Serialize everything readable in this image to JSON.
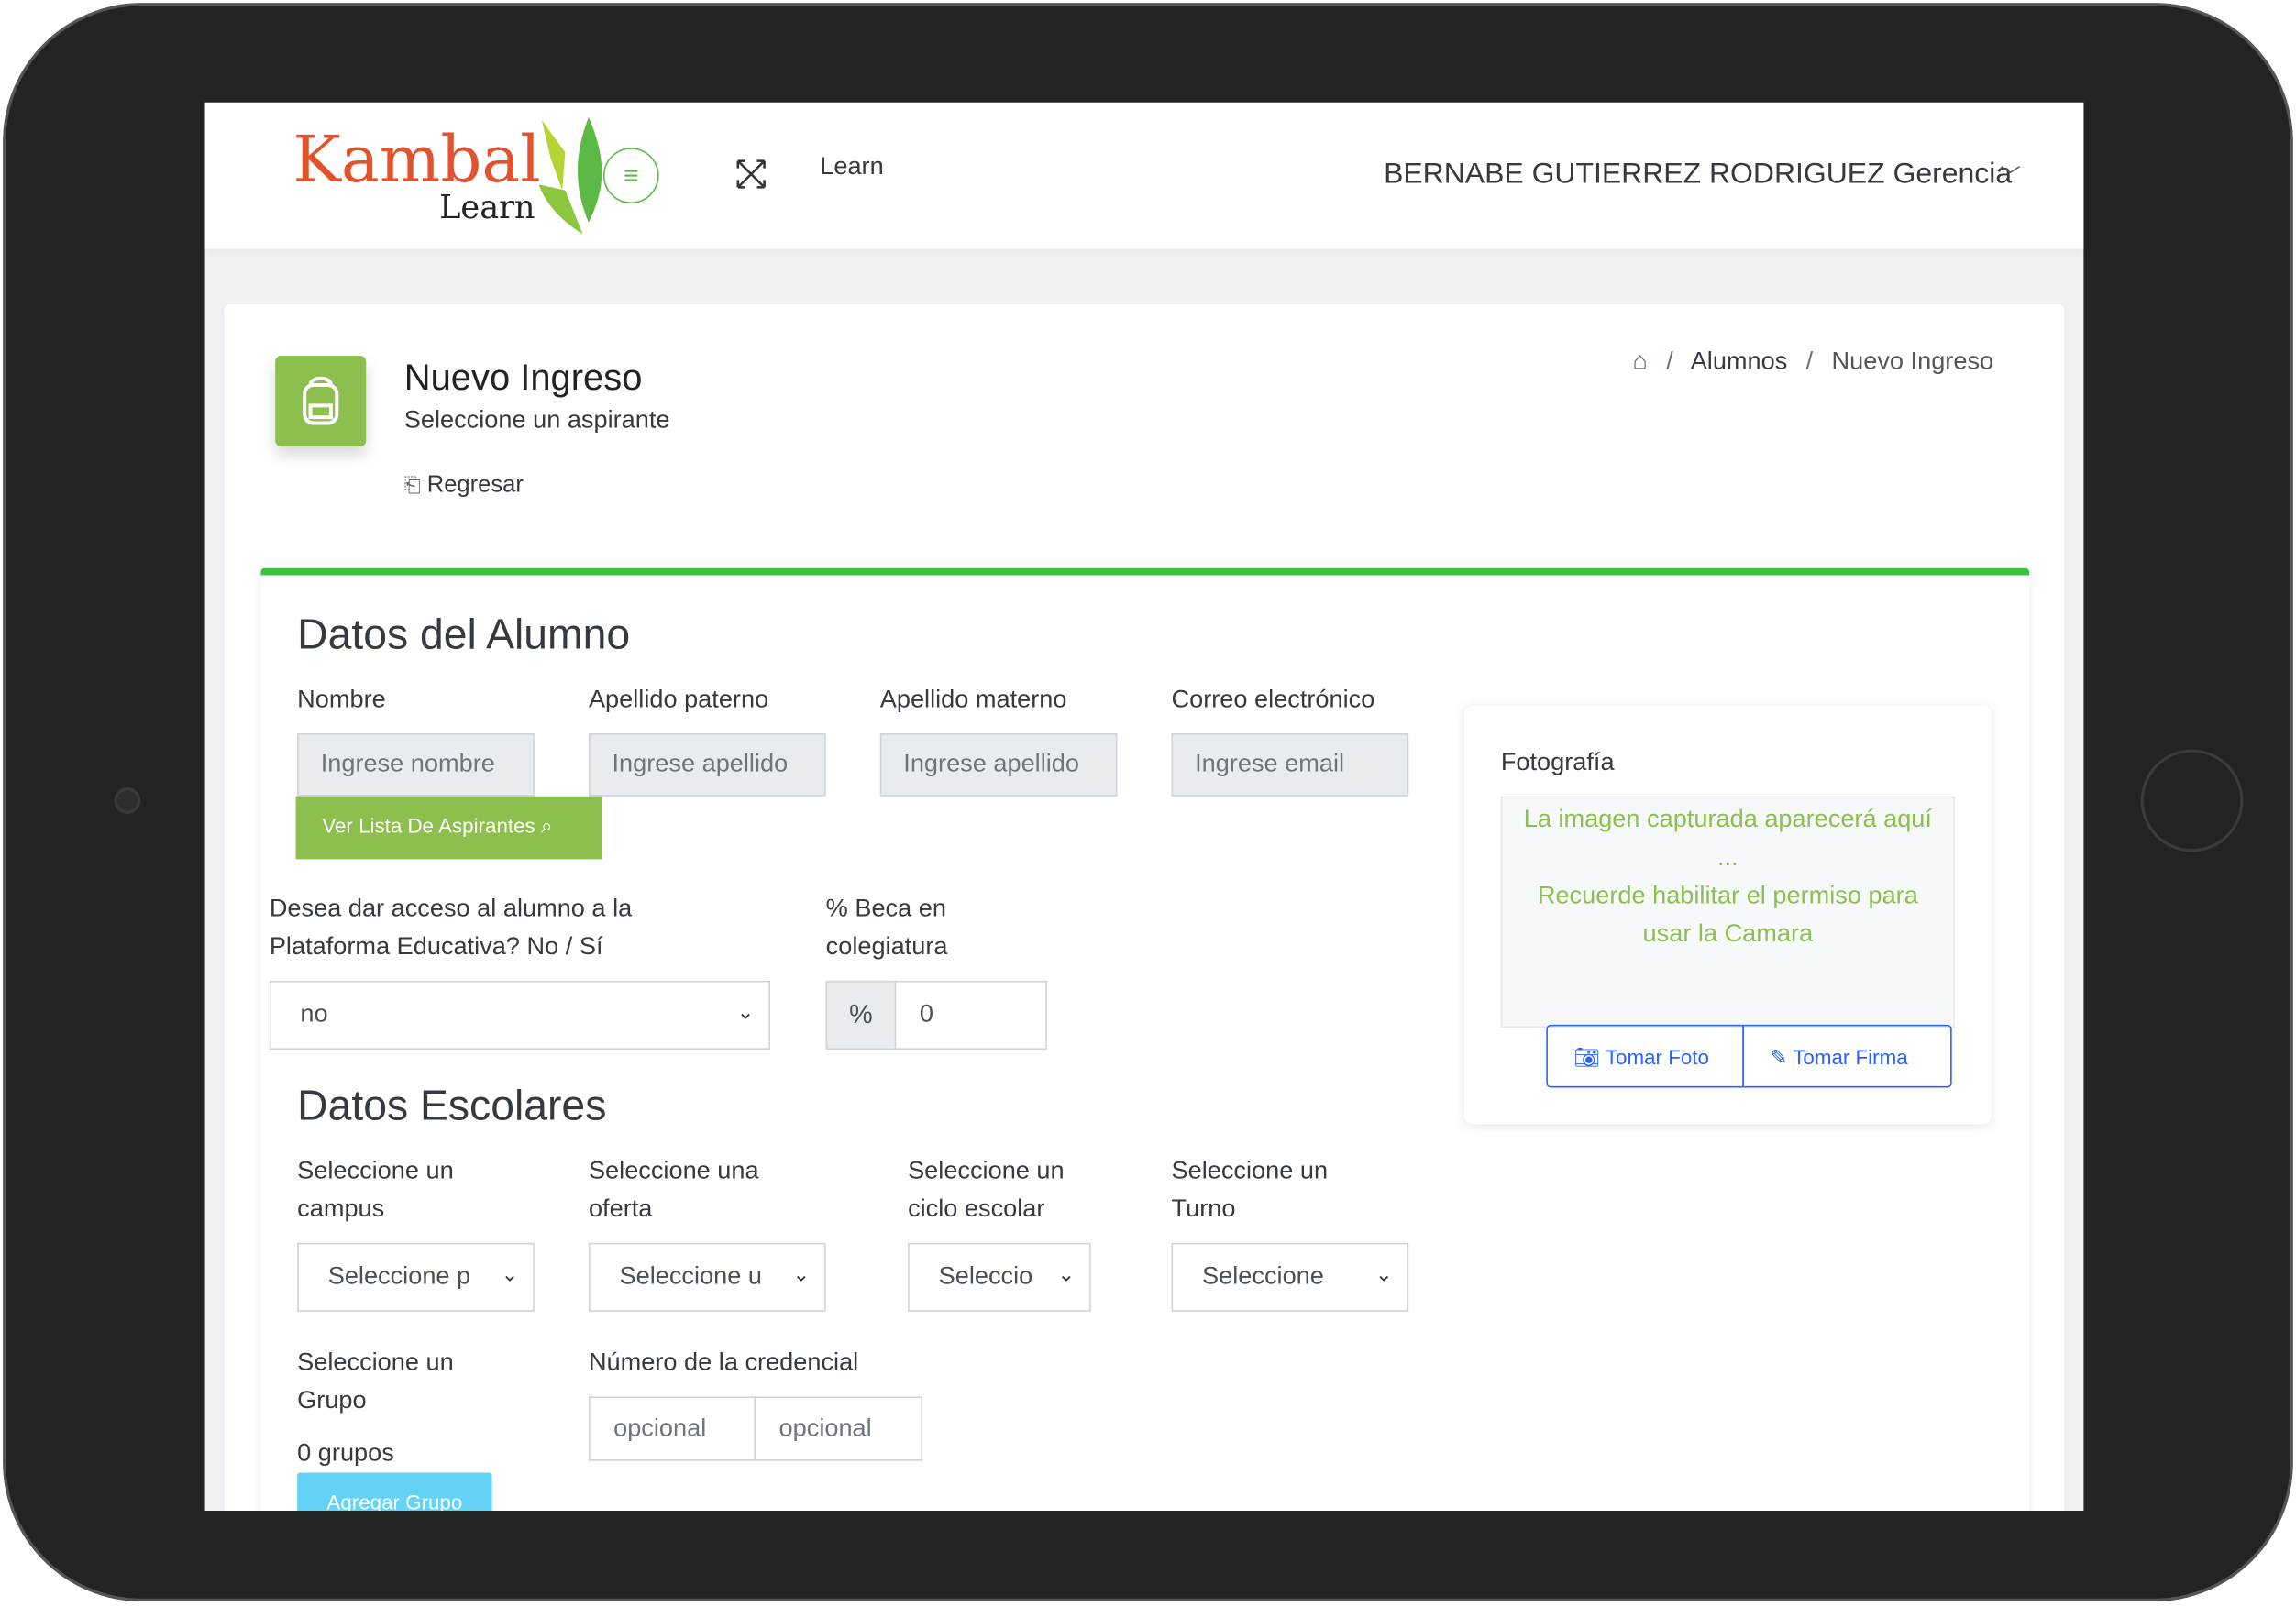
{
  "header": {
    "logo_text": "Kambal",
    "logo_sub": "Learn",
    "nav_link": "Learn",
    "user": "BERNABE GUTIERREZ RODRIGUEZ Gerencia"
  },
  "page": {
    "title": "Nuevo Ingreso",
    "subtitle": "Seleccione un aspirante",
    "back": "Regresar"
  },
  "breadcrumb": {
    "items": [
      "Alumnos",
      "Nuevo Ingreso"
    ]
  },
  "alumno": {
    "heading": "Datos del Alumno",
    "fields": [
      {
        "label": "Nombre",
        "placeholder": "Ingrese nombre"
      },
      {
        "label": "Apellido paterno",
        "placeholder": "Ingrese apellido"
      },
      {
        "label": "Apellido materno",
        "placeholder": "Ingrese apellido"
      },
      {
        "label": "Correo electrónico",
        "placeholder": "Ingrese email"
      }
    ],
    "list_button": "Ver Lista De Aspirantes",
    "access_label_1": "Desea dar acceso al alumno a la",
    "access_label_2": "Plataforma Educativa? No / Sí",
    "access_value": "no",
    "beca_label_1": "% Beca en",
    "beca_label_2": "colegiatura",
    "beca_prefix": "%",
    "beca_value": "0"
  },
  "foto": {
    "label": "Fotografía",
    "msg1": "La imagen capturada aparecerá aquí",
    "msg2": "...",
    "msg3": "Recuerde habilitar el permiso para",
    "msg4": "usar la Camara",
    "take_photo": "Tomar Foto",
    "take_signature": "Tomar Firma"
  },
  "escolares": {
    "heading": "Datos Escolares",
    "selects": [
      {
        "l1": "Seleccione un",
        "l2": "campus",
        "value": "Seleccione p"
      },
      {
        "l1": "Seleccione una",
        "l2": "oferta",
        "value": "Seleccione u"
      },
      {
        "l1": "Seleccione un",
        "l2": "ciclo escolar",
        "value": "Seleccio"
      },
      {
        "l1": "Seleccione un",
        "l2": "Turno",
        "value": "Seleccione"
      }
    ],
    "grupo_l1": "Seleccione un",
    "grupo_l2": "Grupo",
    "grupo_count": "0 grupos",
    "add_group": "Agregar Grupo",
    "cred_label": "Número de la credencial",
    "cred_ph1": "opcional",
    "cred_ph2": "opcional"
  },
  "colors": {
    "accent_green": "#8cbf4d",
    "top_border": "#3ec13e",
    "primary_blue": "#2962ff",
    "info": "#63d2f5",
    "logo_orange": "#e0532d"
  }
}
